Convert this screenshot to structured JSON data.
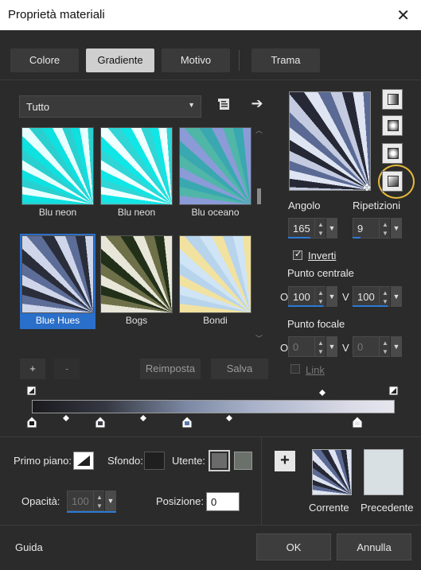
{
  "window": {
    "title": "Proprietà materiali",
    "close_icon": "close-icon"
  },
  "tabs": [
    {
      "label": "Colore",
      "active": false
    },
    {
      "label": "Gradiente",
      "active": true
    },
    {
      "label": "Motivo",
      "active": false
    },
    {
      "label": "Trama",
      "active": false
    }
  ],
  "category": {
    "selected": "Tutto"
  },
  "gradients": [
    {
      "label": "Blu neon",
      "selected": false
    },
    {
      "label": "Blu neon",
      "selected": false
    },
    {
      "label": "Blu oceano",
      "selected": false
    },
    {
      "label": "Blue Hues",
      "selected": true
    },
    {
      "label": "Bogs",
      "selected": false
    },
    {
      "label": "Bondi",
      "selected": false
    }
  ],
  "actions": {
    "add": "+",
    "remove": "-",
    "reset": "Reimposta",
    "save": "Salva"
  },
  "controls": {
    "angle_label": "Angolo",
    "angle_value": "165",
    "repeats_label": "Ripetizioni",
    "repeats_value": "9",
    "invert_label": "Inverti",
    "invert_checked": true,
    "center_label": "Punto centrale",
    "h_prefix": "O",
    "v_prefix": "V",
    "center_h": "100",
    "center_v": "100",
    "focal_label": "Punto focale",
    "focal_h": "0",
    "focal_v": "0",
    "link_label": "Link"
  },
  "bottom": {
    "fg_label": "Primo piano:",
    "bg_label": "Sfondo:",
    "user_label": "Utente:",
    "opacity_label": "Opacità:",
    "opacity_value": "100",
    "position_label": "Posizione:",
    "position_value": "0",
    "add_button": "+",
    "current_label": "Corrente",
    "previous_label": "Precedente",
    "user_swatch_colors": [
      "#6b6b6b",
      "#6a716a"
    ],
    "previous_color": "#d8e0e4"
  },
  "footer": {
    "help": "Guida",
    "ok": "OK",
    "cancel": "Annulla"
  },
  "colors": {
    "accent": "#2a7ad6",
    "highlight_ring": "#e4b93a"
  }
}
